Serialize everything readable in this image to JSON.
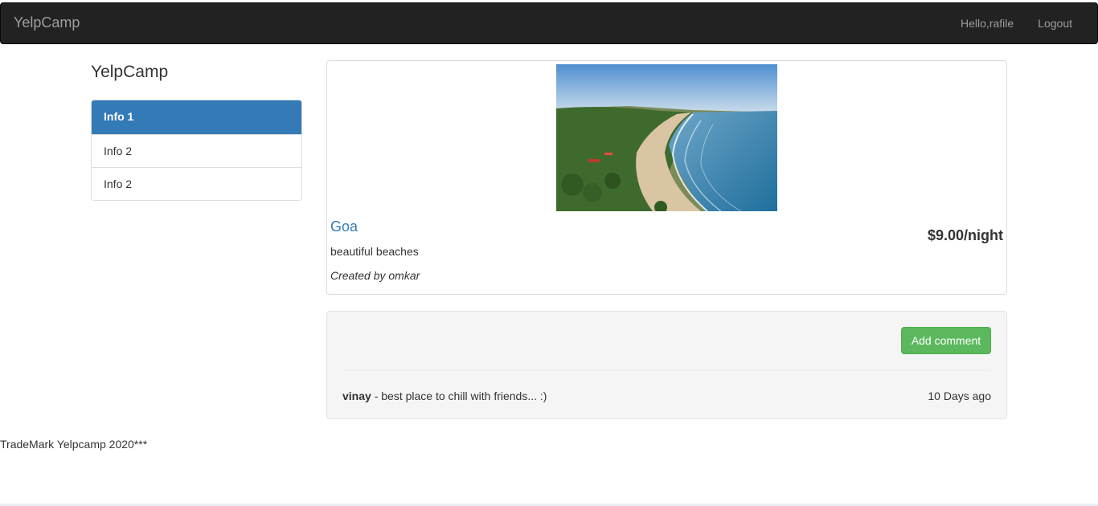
{
  "navbar": {
    "brand": "YelpCamp",
    "greeting": "Hello,rafile",
    "logout": "Logout"
  },
  "sidebar": {
    "lead": "YelpCamp",
    "items": [
      {
        "label": "Info 1",
        "active": true
      },
      {
        "label": "Info 2",
        "active": false
      },
      {
        "label": "Info 2",
        "active": false
      }
    ]
  },
  "campground": {
    "name": "Goa",
    "price": "$9.00/night",
    "description": "beautiful beaches",
    "created_by": "Created by omkar"
  },
  "comments": {
    "add_button": "Add comment",
    "items": [
      {
        "author": "vinay",
        "text": " - best place to chill with friends... :)",
        "time": "10 Days ago"
      }
    ]
  },
  "footer": {
    "text": "TradeMark Yelpcamp 2020***"
  },
  "colors": {
    "navbar_bg": "#222222",
    "primary": "#337ab7",
    "success": "#5cb85c"
  }
}
